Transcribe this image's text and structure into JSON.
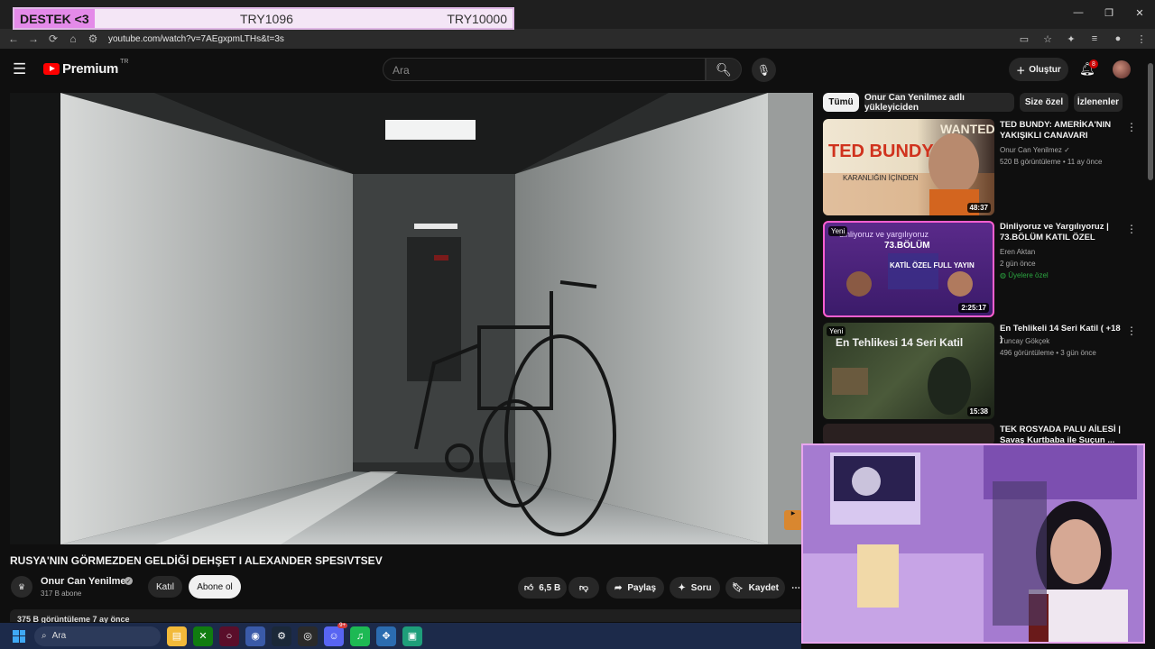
{
  "browser": {
    "url": "youtube.com/watch?v=7AEgxpmLTHs&t=3s",
    "nav_back": "←",
    "nav_forward": "→",
    "nav_reload": "⟳",
    "nav_home": "⌂"
  },
  "overlay": {
    "label": "DESTEK <3",
    "current": "TRY1096",
    "goal": "TRY10000",
    "progress_fraction": 0.11
  },
  "youtube": {
    "brand": "Premium",
    "country": "TR",
    "search_placeholder": "Ara",
    "create_label": "Oluştur",
    "notification_count": "8"
  },
  "video": {
    "title": "RUSYA'NIN GÖRMEZDEN GELDİĞİ DEHŞET I ALEXANDER SPESIVTSEV",
    "channel": "Onur Can Yenilmez",
    "subscribers": "317 B abone",
    "join_label": "Katıl",
    "subscribe_label": "Abone ol",
    "likes": "6,5 B",
    "share_label": "Paylaş",
    "ask_label": "Soru",
    "save_label": "Kaydet",
    "views_line": "375 B görüntüleme  7 ay önce"
  },
  "chips": [
    "Tümü",
    "Onur Can Yenilmez adlı yükleyiciden",
    "Size özel",
    "İzlenenler"
  ],
  "recommended": [
    {
      "title": "TED BUNDY: AMERİKA'NIN YAKIŞIKLI CANAVARI",
      "channel": "Onur Can Yenilmez",
      "meta": "520 B görüntüleme • 11 ay önce",
      "duration": "48:37",
      "thumb_text": "TED BUNDY",
      "thumb_sub": "KARANLIĞIN İÇİNDEN",
      "thumb_wanted": "WANTED"
    },
    {
      "title": "Dinliyoruz ve Yargılıyoruz | 73.BÖLÜM KATIL ÖZEL",
      "channel": "Eren Aktan",
      "meta": "2 gün önce",
      "members": "Üyelere özel",
      "duration": "2:25:17",
      "new": "Yeni",
      "thumb_text": "73.BÖLÜM",
      "thumb_sub": "KATİL ÖZEL FULL YAYIN",
      "thumb_top": "dinliyoruz  ve  yargılıyoruz"
    },
    {
      "title": "En Tehlikeli 14 Seri Katil ( +18 )",
      "channel": "Tuncay Gökçek",
      "meta": "496 görüntüleme • 3 gün önce",
      "duration": "15:38",
      "new": "Yeni",
      "thumb_text": "En Tehlikesi 14 Seri Katil"
    },
    {
      "title": "TEK ROSYADA PALU AİLESİ | Savaş Kurtbaba ile Suçun ...",
      "channel": "",
      "meta": ""
    }
  ],
  "taskbar": {
    "search_label": "Ara",
    "discord_badge": "9+"
  },
  "icons": {
    "menu": "hamburger-icon",
    "search": "search-icon",
    "mic": "mic-icon",
    "bell": "bell-icon"
  }
}
